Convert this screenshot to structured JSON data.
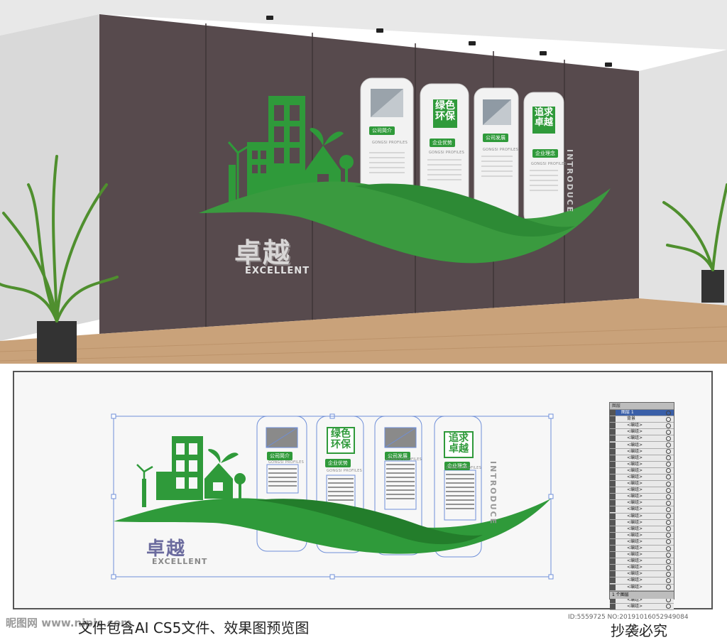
{
  "wall": {
    "headline_cn": "卓越",
    "headline_en": "EXCELLENT",
    "vertical_en": "INTRODUCE",
    "panels": [
      {
        "title": "",
        "tag": "公司简介",
        "sub": "GONGSI PROFILES"
      },
      {
        "title": "绿色\n环保",
        "tag": "企业优势",
        "sub": "GONGSI PROFILES"
      },
      {
        "title": "",
        "tag": "公司发展",
        "sub": "GONGSI PROFILES"
      },
      {
        "title": "追求\n卓越",
        "tag": "企业理念",
        "sub": "GONGSI PROFILES"
      }
    ]
  },
  "blueprint": {
    "headline_cn": "卓越",
    "headline_en": "EXCELLENT",
    "vertical_en": "INTRODUCE",
    "panels": [
      {
        "title": "",
        "tag": "公司简介",
        "sub": "GONGSI PROFILES"
      },
      {
        "title": "绿色\n环保",
        "tag": "企业优势",
        "sub": "GONGSI PROFILES"
      },
      {
        "title": "",
        "tag": "公司发展",
        "sub": "GONGSI PROFILES"
      },
      {
        "title": "追求\n卓越",
        "tag": "企业理念",
        "sub": "GONGSI PROFILES"
      }
    ]
  },
  "layers_panel": {
    "tab": "图层",
    "top_layer": "图层 1",
    "second": "背景",
    "item_label": "<编组>",
    "footer": "1 个图层"
  },
  "footer": {
    "watermark_left": "昵图网 www.nipic.com",
    "caption": "文件包含AI CS5文件、效果图预览图",
    "id_text": "ID:5559725 NO:20191016052949084",
    "right_text": "抄袭必究"
  },
  "colors": {
    "green": "#2f9a3a",
    "wall": "#5a4d50",
    "floor": "#c9a27a"
  }
}
